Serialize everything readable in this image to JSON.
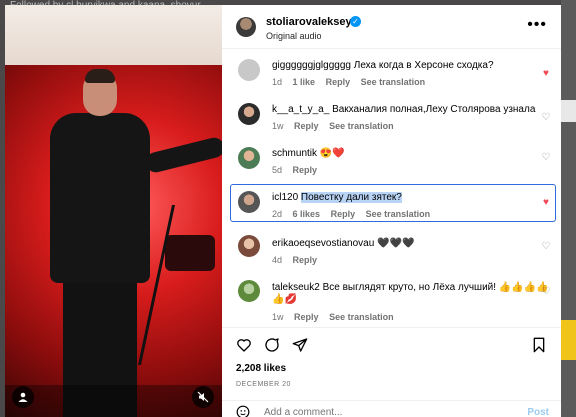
{
  "backdrop": {
    "text": "Followed by cl buryikwa and kaana_shoyur"
  },
  "header": {
    "username": "stoliarovaleksey",
    "audio": "Original audio",
    "verified_icon": "verified-badge-icon",
    "more_icon": "more-options-icon"
  },
  "comments": [
    {
      "user": "giggggggjglggggg",
      "text": "Леха когда в Херсоне сходка?",
      "time": "1d",
      "likes": "1 like",
      "reply": "Reply",
      "translate": "See translation",
      "liked": true
    },
    {
      "user": "k__a_t_y_a_",
      "text": "Вакханалия полная,Леху Столярова узнала",
      "time": "1w",
      "likes": "",
      "reply": "Reply",
      "translate": "See translation",
      "liked": false
    },
    {
      "user": "schmuntik",
      "text": "😍❤️",
      "time": "5d",
      "likes": "",
      "reply": "Reply",
      "translate": "",
      "liked": false
    },
    {
      "user": "icl120",
      "text": "Повестку дали зятек?",
      "time": "2d",
      "likes": "6 likes",
      "reply": "Reply",
      "translate": "See translation",
      "liked": true
    },
    {
      "user": "erikaoeqsevostianovau",
      "text": "🖤🖤🖤",
      "time": "4d",
      "likes": "",
      "reply": "Reply",
      "translate": "",
      "liked": false
    },
    {
      "user": "talekseuk2",
      "text": "Все выглядят круто, но Лёха лучший! 👍👍👍👍",
      "text2": "👍💋",
      "time": "1w",
      "likes": "",
      "reply": "Reply",
      "translate": "See translation",
      "liked": false
    }
  ],
  "actions": {
    "likes": "2,208 likes",
    "date": "DECEMBER 20",
    "comment_placeholder": "Add a comment...",
    "post": "Post"
  },
  "colors": {
    "accent": "#0095f6",
    "like_red": "#ed4956",
    "selection": "#2f6bdc"
  }
}
